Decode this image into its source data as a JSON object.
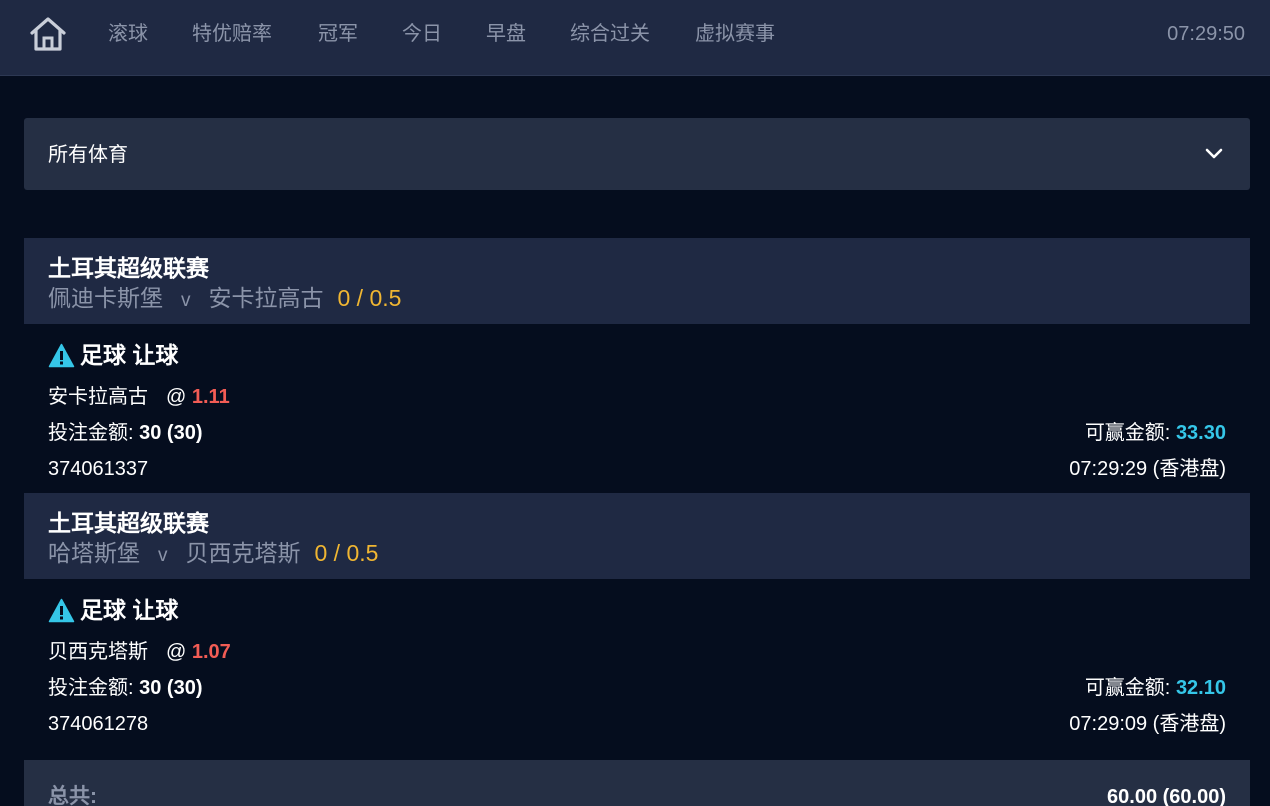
{
  "nav": {
    "items": [
      "滚球",
      "特优赔率",
      "冠军",
      "今日",
      "早盘",
      "综合过关",
      "虚拟赛事"
    ],
    "clock": "07:29:50"
  },
  "filter": {
    "label": "所有体育"
  },
  "bets": [
    {
      "league": "土耳其超级联赛",
      "home": "佩迪卡斯堡",
      "vs": "v",
      "away": "安卡拉高古",
      "handicap": "0 / 0.5",
      "type": "足球 让球",
      "selection": "安卡拉高古",
      "at": "@",
      "odds": "1.11",
      "stake_label": "投注金额:",
      "stake_value": "30 (30)",
      "win_label": "可赢金额:",
      "win_value": "33.30",
      "ticket": "374061337",
      "time": "07:29:29 (香港盘)"
    },
    {
      "league": "土耳其超级联赛",
      "home": "哈塔斯堡",
      "vs": "v",
      "away": "贝西克塔斯",
      "handicap": "0 / 0.5",
      "type": "足球 让球",
      "selection": "贝西克塔斯",
      "at": "@",
      "odds": "1.07",
      "stake_label": "投注金额:",
      "stake_value": "30 (30)",
      "win_label": "可赢金额:",
      "win_value": "32.10",
      "ticket": "374061278",
      "time": "07:29:09 (香港盘)"
    }
  ],
  "total": {
    "label": "总共:",
    "value": "60.00 (60.00)"
  },
  "colors": {
    "accent_cyan": "#35c6e8",
    "odds_red": "#f25c55",
    "handicap_gold": "#f0b632"
  },
  "icons": [
    "home-icon",
    "chevron-down-icon",
    "warning-icon"
  ]
}
